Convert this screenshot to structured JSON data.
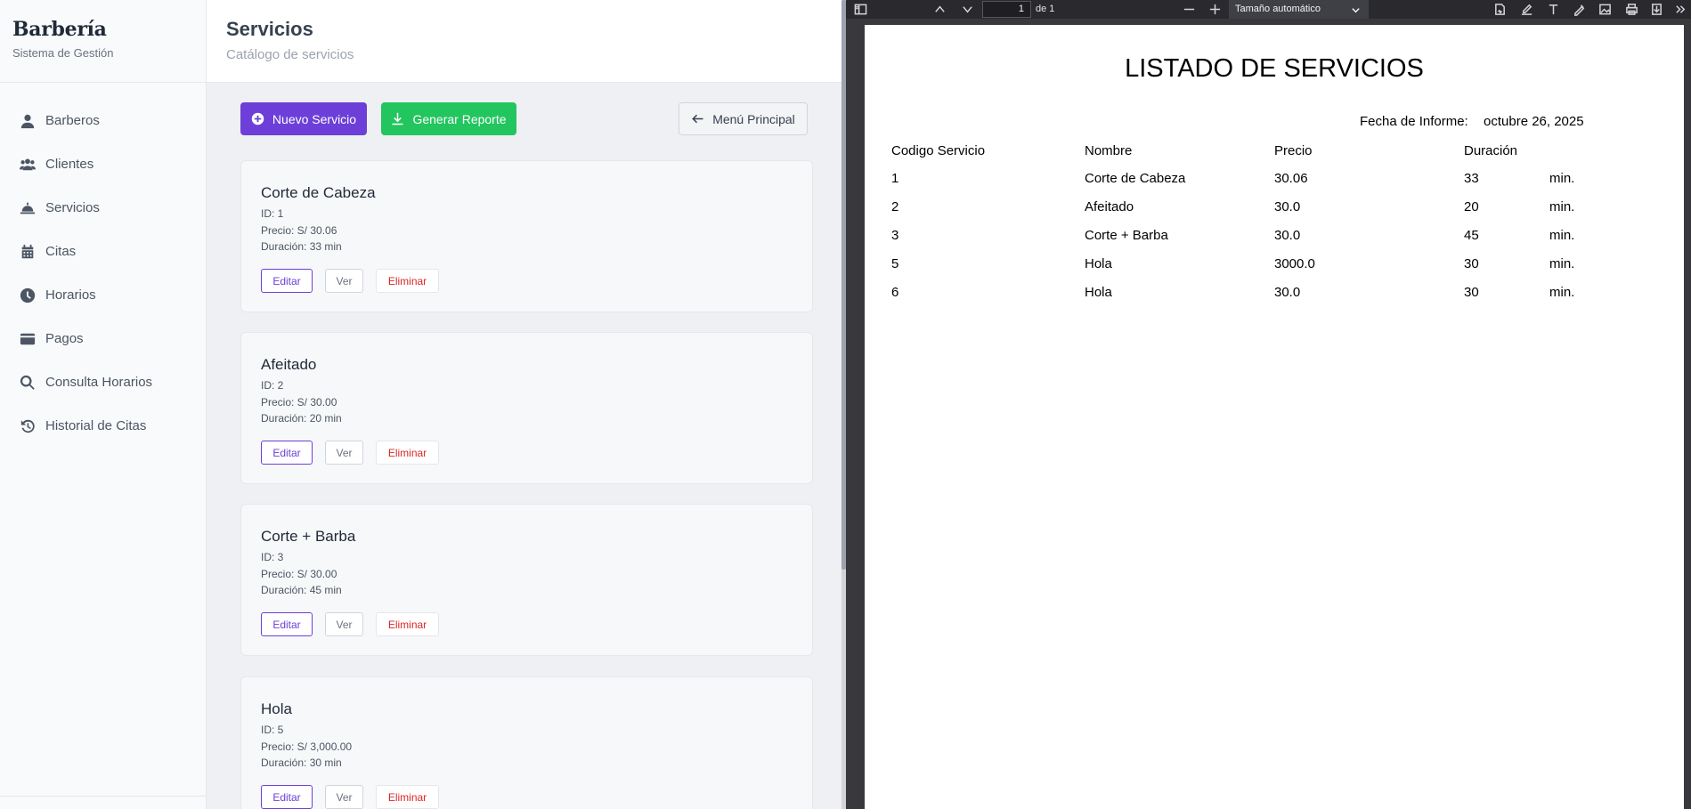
{
  "sidebar": {
    "brand": "Barbería",
    "subtitle": "Sistema de Gestión",
    "items": [
      {
        "label": "Barberos",
        "icon": "user-icon"
      },
      {
        "label": "Clientes",
        "icon": "users-icon"
      },
      {
        "label": "Servicios",
        "icon": "service-bell-icon"
      },
      {
        "label": "Citas",
        "icon": "calendar-icon"
      },
      {
        "label": "Horarios",
        "icon": "clock-icon"
      },
      {
        "label": "Pagos",
        "icon": "credit-card-icon"
      },
      {
        "label": "Consulta Horarios",
        "icon": "search-icon"
      },
      {
        "label": "Historial de Citas",
        "icon": "history-icon"
      }
    ]
  },
  "header": {
    "title": "Servicios",
    "subtitle": "Catálogo de servicios"
  },
  "toolbar": {
    "new_label": "Nuevo Servicio",
    "report_label": "Generar Reporte",
    "menu_label": "Menú Principal"
  },
  "services": [
    {
      "name": "Corte de Cabeza",
      "id": "ID: 1",
      "price": "Precio: S/ 30.06",
      "duration": "Duración: 33 min"
    },
    {
      "name": "Afeitado",
      "id": "ID: 2",
      "price": "Precio: S/ 30.00",
      "duration": "Duración: 20 min"
    },
    {
      "name": "Corte + Barba",
      "id": "ID: 3",
      "price": "Precio: S/ 30.00",
      "duration": "Duración: 45 min"
    },
    {
      "name": "Hola",
      "id": "ID: 5",
      "price": "Precio: S/ 3,000.00",
      "duration": "Duración: 30 min"
    }
  ],
  "card_actions": {
    "edit": "Editar",
    "view": "Ver",
    "delete": "Eliminar"
  },
  "pdf_viewer": {
    "page_number": "1",
    "page_of": "de 1",
    "zoom": "Tamaño automático"
  },
  "report": {
    "title": "LISTADO DE SERVICIOS",
    "date_label": "Fecha de Informe:",
    "date": "octubre 26, 2025",
    "columns": [
      "Codigo Servicio",
      "Nombre",
      "Precio",
      "Duración"
    ],
    "rows": [
      {
        "code": "1",
        "name": "Corte de Cabeza",
        "price": "30.06",
        "duration": "33",
        "unit": "min."
      },
      {
        "code": "2",
        "name": "Afeitado",
        "price": "30.0",
        "duration": "20",
        "unit": "min."
      },
      {
        "code": "3",
        "name": "Corte + Barba",
        "price": "30.0",
        "duration": "45",
        "unit": "min."
      },
      {
        "code": "5",
        "name": "Hola",
        "price": "3000.0",
        "duration": "30",
        "unit": "min."
      },
      {
        "code": "6",
        "name": "Hola",
        "price": "30.0",
        "duration": "30",
        "unit": "min."
      }
    ]
  },
  "colors": {
    "primary": "#6d3fd8",
    "success": "#22c55e",
    "danger": "#dc2626"
  }
}
